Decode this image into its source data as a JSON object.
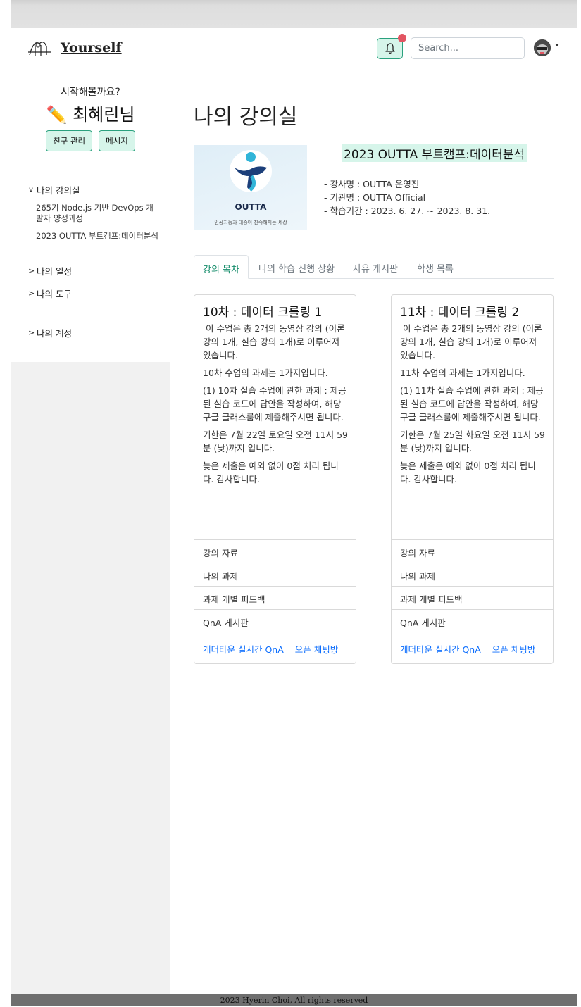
{
  "brand": {
    "name": "Yourself"
  },
  "navbar": {
    "search_placeholder": "Search..."
  },
  "sidebar": {
    "greeting": "시작해볼까요?",
    "user_name": "✏️ 최혜린님",
    "buttons": [
      "친구 관리",
      "메시지"
    ],
    "menu": [
      {
        "label": "나의 강의실",
        "expanded": true,
        "children": [
          "265기 Node.js 기반 DevOps 개발자 양성과정",
          "2023 OUTTA 부트캠프:데이터분석"
        ]
      },
      {
        "label": "나의 일정",
        "expanded": false
      },
      {
        "label": "나의 도구",
        "expanded": false
      }
    ],
    "account": {
      "label": "나의 계정"
    }
  },
  "main": {
    "title": "나의 강의실",
    "course": {
      "logo_text": "OUTTA",
      "logo_tagline": "인공지능과 대중이 친숙해지는 세상",
      "title": "2023 OUTTA 부트캠프:데이터분석",
      "instructor": "- 강사명 : OUTTA 운영진",
      "institution": "- 기관명 : OUTTA Official",
      "period": "- 학습기간 : 2023. 6. 27. ~ 2023. 8. 31."
    },
    "tabs": [
      "강의 목차",
      "나의 학습 진행 상황",
      "자유 게시판",
      "학생 목록"
    ],
    "active_tab": "강의 목차",
    "cards": [
      {
        "title": "10차 : 데이터 크롤링 1",
        "paragraphs": [
          " 이 수업은 총 2개의 동영상 강의 (이론 강의 1개, 실습 강의 1개)로 이루어져 있습니다.",
          "10차 수업의 과제는 1가지입니다.",
          "(1) 10차 실습 수업에 관한 과제 : 제공된 실습 코드에 답안을 작성하여, 해당 구글 클래스룸에 제출해주시면 됩니다.",
          "기한은 7월 22일 토요일 오전 11시 59분 (낮)까지 입니다.",
          "늦은 제출은 예외 없이 0점 처리 됩니다. 감사합니다."
        ],
        "rows": [
          "강의 자료",
          "나의 과제",
          "과제 개별 피드백",
          "QnA 게시판"
        ],
        "links": [
          "게더타운 실시간 QnA",
          "오픈 채팅방"
        ]
      },
      {
        "title": "11차 : 데이터 크롤링 2",
        "paragraphs": [
          " 이 수업은 총 2개의 동영상 강의 (이론 강의 1개, 실습 강의 1개)로 이루어져 있습니다.",
          "11차 수업의 과제는 1가지입니다.",
          "(1) 11차 실습 수업에 관한 과제 : 제공된 실습 코드에 답안을 작성하여, 해당 구글 클래스룸에 제출해주시면 됩니다.",
          "기한은 7월 25일 화요일 오전 11시 59분 (낮)까지 입니다.",
          "늦은 제출은 예외 없이 0점 처리 됩니다. 감사합니다."
        ],
        "rows": [
          "강의 자료",
          "나의 과제",
          "과제 개별 피드백",
          "QnA 게시판"
        ],
        "links": [
          "게더타운 실시간 QnA",
          "오픈 채팅방"
        ]
      }
    ]
  },
  "footer": {
    "text": "2023 Hyerin Choi,  All rights reserved"
  },
  "colors": {
    "accent_bg": "#d6f5ea",
    "accent_border": "#2aa17e",
    "notification": "#e25562",
    "link": "#0d6efd"
  }
}
